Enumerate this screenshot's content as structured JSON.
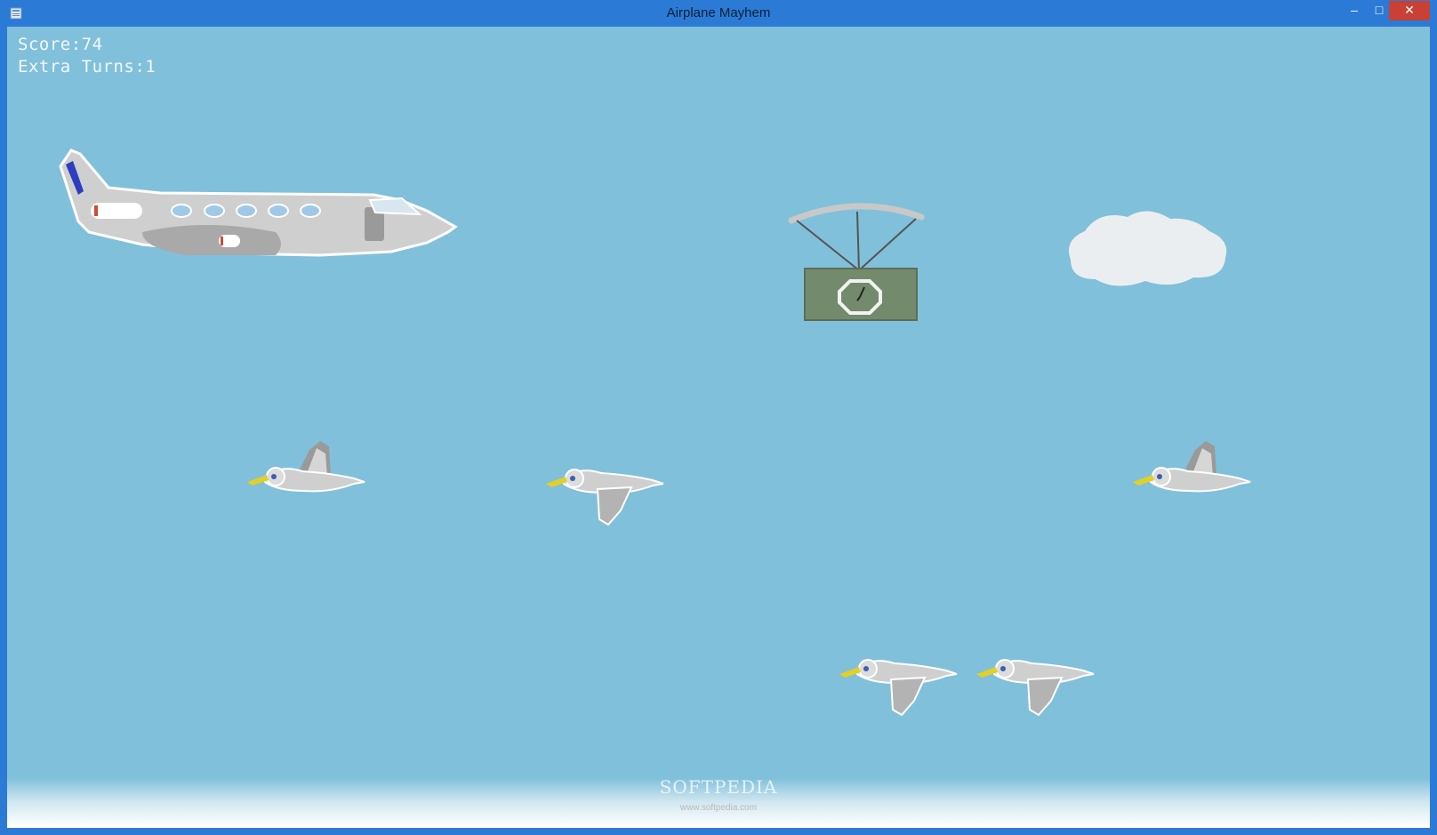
{
  "window": {
    "title": "Airplane Mayhem",
    "controls": {
      "minimize": "–",
      "maximize": "□",
      "close": "✕"
    }
  },
  "hud": {
    "score_label": "Score:",
    "score_value": "74",
    "extra_turns_label": "Extra Turns:",
    "extra_turns_value": "1"
  },
  "sprites": {
    "player": "airplane-icon",
    "supply_drop": "parachute-crate-clock-icon",
    "cloud": "cloud-icon",
    "birds": [
      "seagull-icon",
      "seagull-icon",
      "seagull-icon",
      "seagull-icon",
      "seagull-icon"
    ]
  },
  "watermark": {
    "brand": "SOFTPEDIA",
    "url": "www.softpedia.com"
  },
  "colors": {
    "sky": "#80c0db",
    "titlebar": "#2b7bd6",
    "close_button": "#c94035",
    "plane_stripe": "#2c3dbf",
    "crate": "#738a6c",
    "bird_beak": "#e1cf2a"
  }
}
